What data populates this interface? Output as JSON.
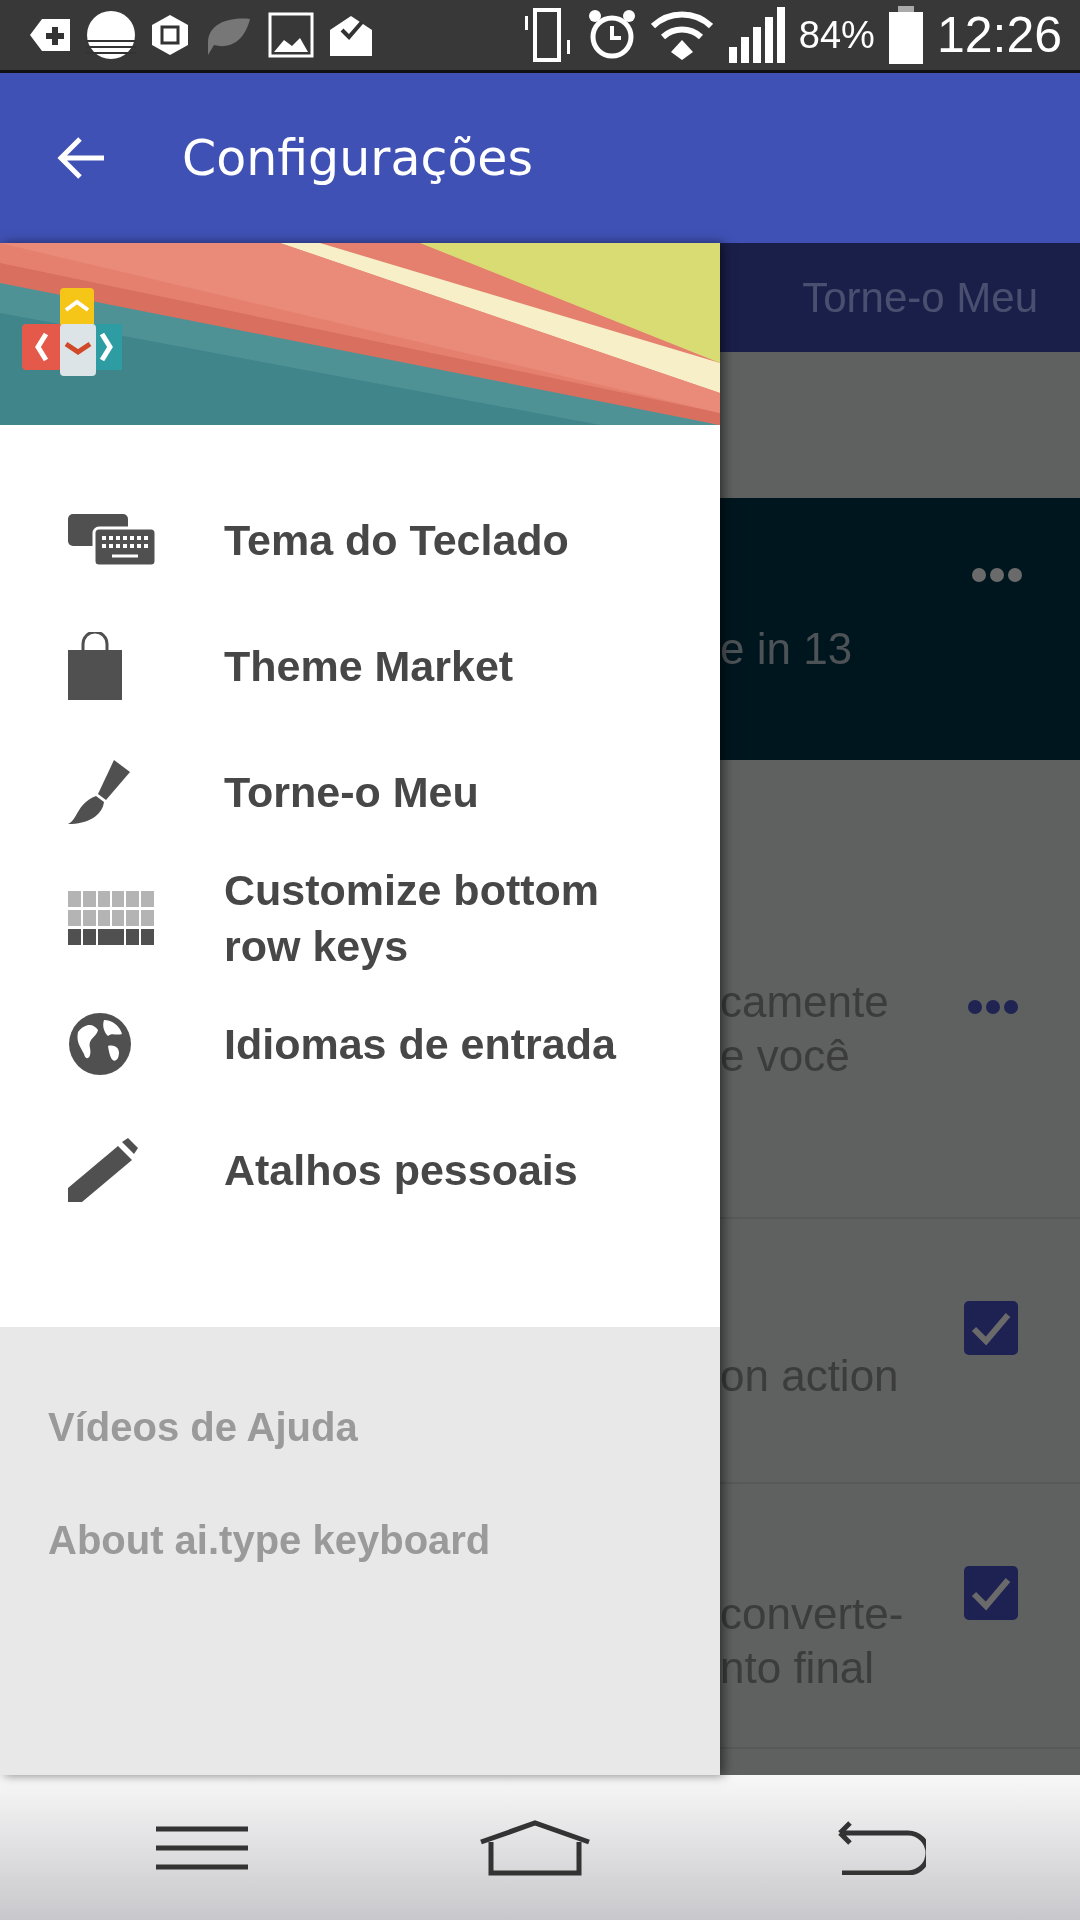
{
  "status_bar": {
    "battery": "84%",
    "time": "12:26"
  },
  "app_bar": {
    "title": "Configurações"
  },
  "background": {
    "tab": "Torne-o Meu",
    "banner_text": "e in 13",
    "rows": [
      {
        "kind": "menu",
        "lines": [
          "camente",
          "e você"
        ]
      },
      {
        "kind": "checkbox",
        "lines": [
          "on action"
        ],
        "checked": true
      },
      {
        "kind": "checkbox",
        "lines": [
          "converte-",
          "nto final"
        ],
        "checked": true
      }
    ]
  },
  "drawer": {
    "items": [
      {
        "kind": "keyboards",
        "label": "Tema do Teclado"
      },
      {
        "kind": "bag",
        "label": "Theme Market"
      },
      {
        "kind": "brush",
        "label": "Torne-o Meu"
      },
      {
        "kind": "keys",
        "label": "Customize bottom row keys"
      },
      {
        "kind": "globe",
        "label": "Idiomas de entrada"
      },
      {
        "kind": "pencil",
        "label": "Atalhos pessoais"
      }
    ],
    "footer": [
      "Vídeos de Ajuda",
      "About ai.type keyboard"
    ]
  }
}
